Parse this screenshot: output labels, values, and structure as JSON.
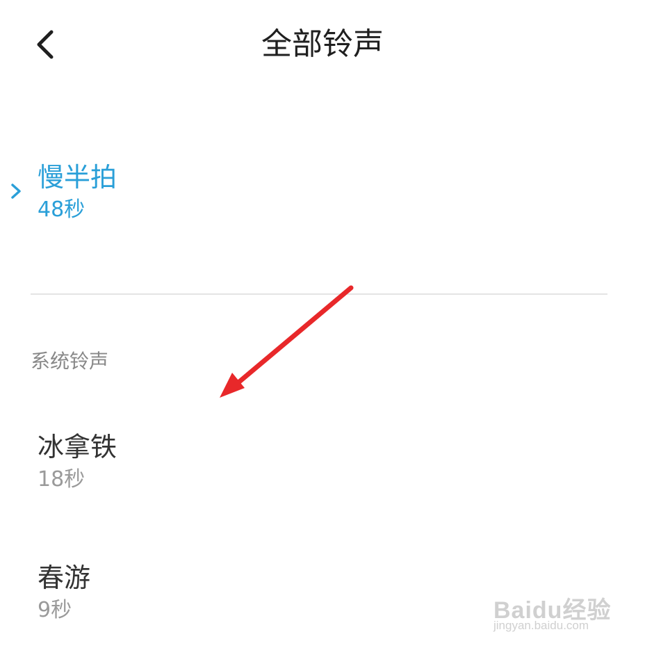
{
  "header": {
    "title": "全部铃声"
  },
  "current": {
    "name": "慢半拍",
    "duration": "48秒"
  },
  "section": {
    "label": "系统铃声"
  },
  "ringtones": [
    {
      "name": "冰拿铁",
      "duration": "18秒"
    },
    {
      "name": "春游",
      "duration": "9秒"
    }
  ],
  "watermark": {
    "brand": "Baidu经验",
    "url": "jingyan.baidu.com"
  },
  "colors": {
    "accent": "#2a9fd8",
    "annotation_arrow": "#e8282a",
    "divider": "#e4e4e4"
  },
  "icons": {
    "back": "chevron-left-icon",
    "selected": "chevron-right-icon"
  }
}
